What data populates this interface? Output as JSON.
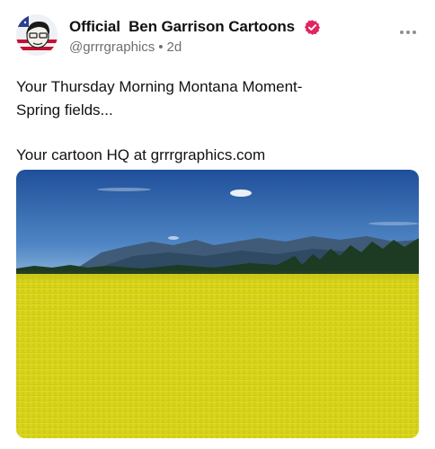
{
  "post": {
    "author": {
      "display_name": "Official  Ben Garrison Cartoons",
      "handle": "@grrrgraphics",
      "separator": "•",
      "time": "2d",
      "verified_icon": "verified-check-badge",
      "verified_color": "#e0245e",
      "avatar_icon": "cartoon-avatar-american-flag"
    },
    "menu_icon": "more-horizontal-icon",
    "text": {
      "line1": "Your Thursday Morning Montana Moment-",
      "line2": "Spring fields...",
      "line3": "Your cartoon HQ at grrrgraphics.com"
    },
    "media": {
      "icon": "landscape-photo-yellow-canola-field-mountains",
      "colors": {
        "sky_top": "#1f4f9a",
        "sky_bottom": "#6e9fd0",
        "mountains": "#3b5570",
        "trees": "#1b3a22",
        "field": "#d8d41c"
      }
    }
  }
}
